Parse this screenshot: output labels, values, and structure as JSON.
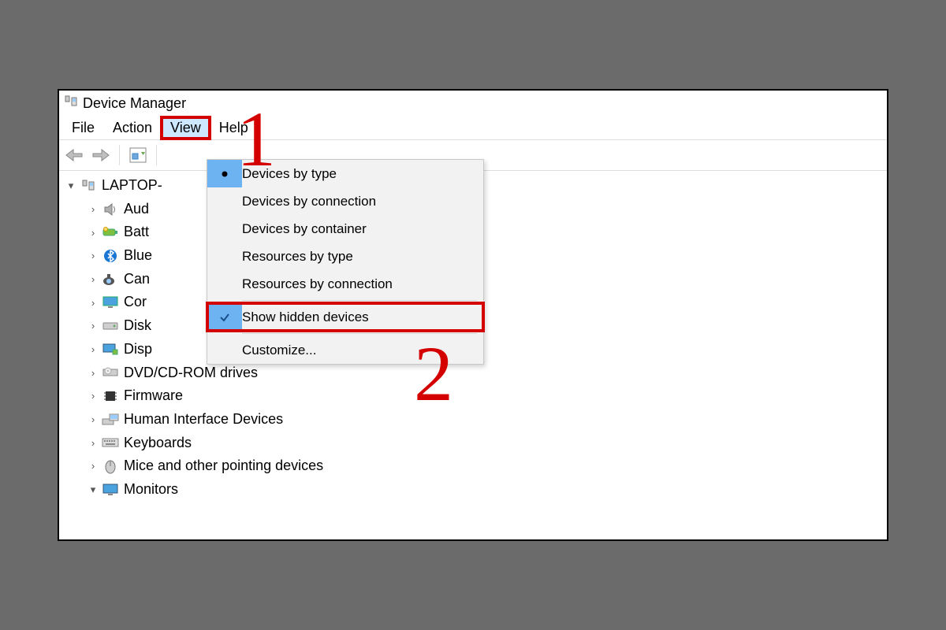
{
  "window": {
    "title": "Device Manager"
  },
  "menubar": {
    "file": "File",
    "action": "Action",
    "view": "View",
    "help": "Help"
  },
  "dropdown": {
    "devices_by_type": "Devices by type",
    "devices_by_connection": "Devices by connection",
    "devices_by_container": "Devices by container",
    "resources_by_type": "Resources by type",
    "resources_by_connection": "Resources by connection",
    "show_hidden": "Show hidden devices",
    "customize": "Customize..."
  },
  "tree": {
    "root": "LAPTOP-",
    "items": [
      "Aud",
      "Batt",
      "Blue",
      "Can",
      "Cor",
      "Disk",
      "Disp",
      "DVD/CD-ROM drives",
      "Firmware",
      "Human Interface Devices",
      "Keyboards",
      "Mice and other pointing devices",
      "Monitors"
    ]
  },
  "annotations": {
    "one": "1",
    "two": "2"
  }
}
